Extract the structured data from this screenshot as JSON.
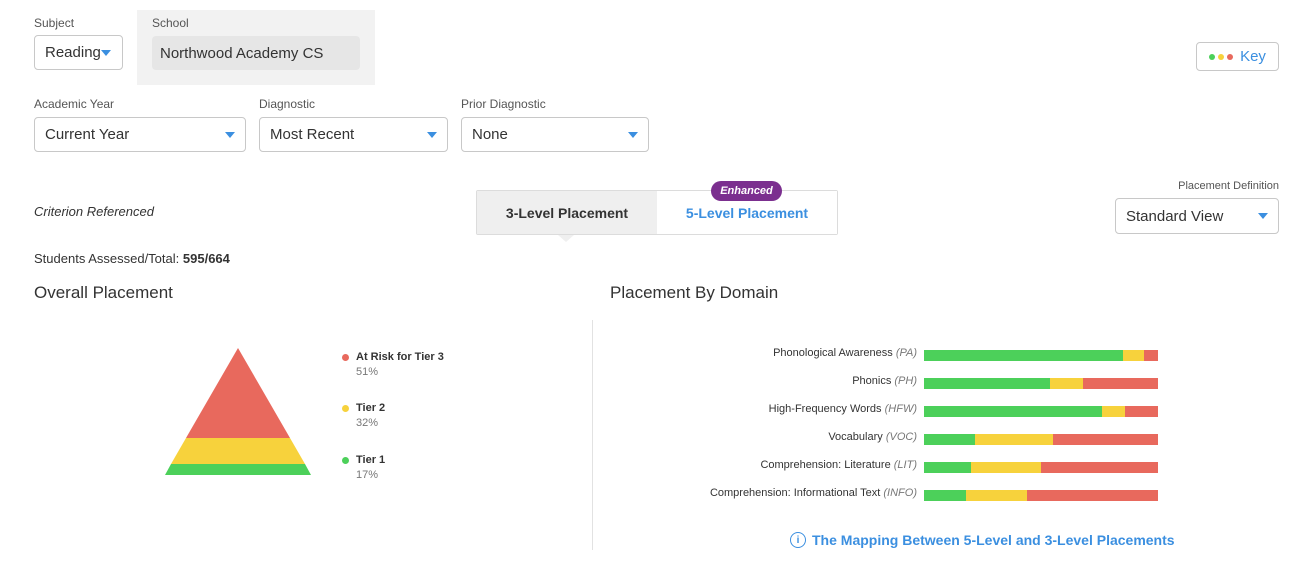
{
  "filters": {
    "subject_label": "Subject",
    "subject_value": "Reading",
    "school_label": "School",
    "school_value": "Northwood Academy CS",
    "academic_year_label": "Academic Year",
    "academic_year_value": "Current Year",
    "diagnostic_label": "Diagnostic",
    "diagnostic_value": "Most Recent",
    "prior_diagnostic_label": "Prior Diagnostic",
    "prior_diagnostic_value": "None"
  },
  "key_button": {
    "label": "Key",
    "dot_colors": [
      "#4cd05a",
      "#f7d23c",
      "#e8695d"
    ]
  },
  "criterion_label": "Criterion Referenced",
  "placement_toggle": {
    "three_level": "3-Level Placement",
    "five_level": "5-Level Placement",
    "badge": "Enhanced",
    "active": "3-Level Placement"
  },
  "placement_definition": {
    "label": "Placement Definition",
    "value": "Standard View"
  },
  "students": {
    "label": "Students Assessed/Total:",
    "value": "595/664"
  },
  "overall": {
    "title": "Overall Placement",
    "legend": [
      {
        "name": "At Risk for Tier 3",
        "pct": "51%",
        "color": "#e8695d"
      },
      {
        "name": "Tier 2",
        "pct": "32%",
        "color": "#f7d23c"
      },
      {
        "name": "Tier 1",
        "pct": "17%",
        "color": "#4cd05a"
      }
    ]
  },
  "domain": {
    "title": "Placement By Domain",
    "rows": [
      {
        "label": "Phonological Awareness",
        "abbr": "(PA)",
        "green": 85,
        "yellow": 9,
        "red": 6
      },
      {
        "label": "Phonics",
        "abbr": "(PH)",
        "green": 54,
        "yellow": 14,
        "red": 32
      },
      {
        "label": "High-Frequency Words",
        "abbr": "(HFW)",
        "green": 76,
        "yellow": 10,
        "red": 14
      },
      {
        "label": "Vocabulary",
        "abbr": "(VOC)",
        "green": 22,
        "yellow": 33,
        "red": 45
      },
      {
        "label": "Comprehension: Literature",
        "abbr": "(LIT)",
        "green": 20,
        "yellow": 30,
        "red": 50
      },
      {
        "label": "Comprehension: Informational Text",
        "abbr": "(INFO)",
        "green": 18,
        "yellow": 26,
        "red": 56
      }
    ],
    "colors": {
      "green": "#4cd05a",
      "yellow": "#f7d23c",
      "red": "#e8695d"
    }
  },
  "mapping_link": "The Mapping Between 5-Level and 3-Level Placements"
}
